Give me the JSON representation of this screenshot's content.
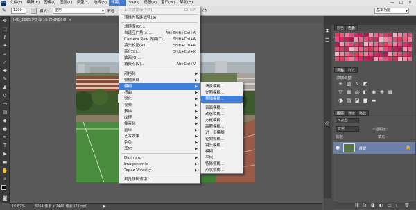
{
  "menubar": {
    "app_logo": "Ps",
    "items": [
      "文件(F)",
      "编辑(E)",
      "图像(I)",
      "图层(L)",
      "类型(Y)",
      "选择(S)",
      "滤镜(T)",
      "3D(D)",
      "视图(V)",
      "窗口(W)",
      "帮助(H)"
    ],
    "active_index": 6,
    "window_controls": [
      "—",
      "□",
      "✕"
    ]
  },
  "optionsbar": {
    "brush_size": "1200",
    "mode_label": "模式:",
    "mode_value": "正常",
    "opacity_label": "不透",
    "workspace_value": "基本功能"
  },
  "document": {
    "tab_title": "IMG_1195.JPG @ 16.7%(RGB/8)",
    "tab_close": "×",
    "zoom": "16.67%",
    "doc_info": "3264 像素 x 2448 像素 (72 ppi)"
  },
  "filter_menu": {
    "items": [
      {
        "label": "上次滤镜操作(F)",
        "shortcut": "Ctrl+F",
        "disabled": true
      },
      {
        "label": "转换为智能滤镜(S)",
        "shortcut": ""
      },
      {
        "label": "滤镜库(G)...",
        "shortcut": ""
      },
      {
        "label": "自适应广角(A)...",
        "shortcut": "Alt+Shift+Ctrl+A"
      },
      {
        "label": "Camera Raw 滤镜(C)...",
        "shortcut": "Shift+Ctrl+A"
      },
      {
        "label": "镜头校正(R)...",
        "shortcut": "Shift+Ctrl+R"
      },
      {
        "label": "液化(L)...",
        "shortcut": "Shift+Ctrl+X"
      },
      {
        "label": "油画(O)...",
        "shortcut": ""
      },
      {
        "label": "消失点(V)...",
        "shortcut": "Alt+Ctrl+V"
      },
      {
        "label": "风格化",
        "submenu": true
      },
      {
        "label": "模糊画廊",
        "submenu": true
      },
      {
        "label": "模糊",
        "submenu": true,
        "highlighted": true
      },
      {
        "label": "扭曲",
        "submenu": true
      },
      {
        "label": "锐化",
        "submenu": true
      },
      {
        "label": "视频",
        "submenu": true
      },
      {
        "label": "素描",
        "submenu": true
      },
      {
        "label": "纹理",
        "submenu": true
      },
      {
        "label": "像素化",
        "submenu": true
      },
      {
        "label": "渲染",
        "submenu": true
      },
      {
        "label": "艺术效果",
        "submenu": true
      },
      {
        "label": "杂色",
        "submenu": true
      },
      {
        "label": "其它",
        "submenu": true
      },
      {
        "label": "Digimarc",
        "submenu": true
      },
      {
        "label": "Imagenomic",
        "submenu": true
      },
      {
        "label": "Topaz Vivacity",
        "submenu": true
      },
      {
        "label": "浏览联机滤镜..."
      }
    ]
  },
  "blur_submenu": {
    "items": [
      "场景模糊...",
      "光圈模糊...",
      "移轴模糊...",
      "表面模糊...",
      "动感模糊...",
      "方框模糊...",
      "高斯模糊...",
      "进一步模糊",
      "径向模糊...",
      "镜头模糊...",
      "模糊",
      "平均",
      "特殊模糊...",
      "形状模糊..."
    ],
    "highlighted_index": 2
  },
  "right_panels": {
    "swatch_tabs": [
      "颜色",
      "色板"
    ],
    "adj_tabs": [
      "调整",
      "样式"
    ],
    "adj_title": "添加调整",
    "layer_tabs": [
      "图层",
      "通道",
      "路径"
    ],
    "kind_label": "ρ 类型",
    "blend_mode": "正常",
    "opacity_label": "不透明度:",
    "lock_label": "锁定:",
    "fill_label": "填充:",
    "layer_name": "背景",
    "lock_icon": "🔒"
  }
}
